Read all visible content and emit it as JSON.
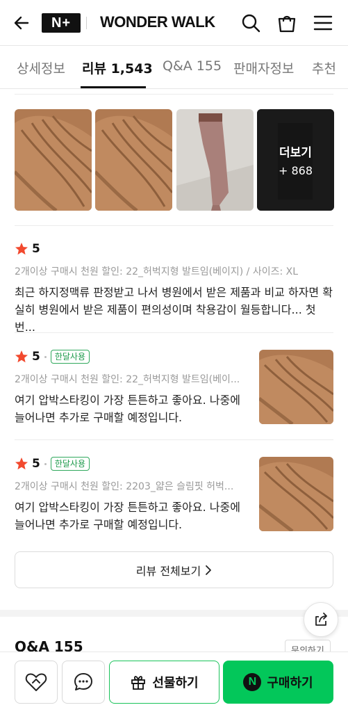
{
  "header": {
    "logo_text": "N+",
    "brand": "WONDER WALK"
  },
  "tabs": [
    {
      "label": "상세정보"
    },
    {
      "label": "리뷰 1,543"
    },
    {
      "label": "Q&A 155"
    },
    {
      "label": "판매자정보"
    },
    {
      "label": "추천"
    }
  ],
  "photos": {
    "more_label": "더보기",
    "more_count": "+ 868"
  },
  "reviews": [
    {
      "rating": "5",
      "badge": "",
      "option": "2개이상 구매시 천원 할인: 22_허벅지형 발트임(베이지) / 사이즈: XL",
      "text": "최근 하지정맥류 판정받고 나서 병원에서 받은 제품과 비교 하자면 확실히 병원에서 받은 제품이 편의성이며 착용감이 월등합니다... 첫번..."
    },
    {
      "rating": "5",
      "badge": "한달사용",
      "option": "2개이상 구매시 천원 할인: 22_허벅지형 발트임(베이...",
      "text": "여기 압박스타킹이 가장 튼튼하고 좋아요. 나중에 늘어나면 추가로 구매할 예정입니다."
    },
    {
      "rating": "5",
      "badge": "한달사용",
      "option": "2개이상 구매시 천원 할인: 2203_얇은 슬림핏 허벅...",
      "text": "여기 압박스타킹이 가장 튼튼하고 좋아요. 나중에 늘어나면 추가로 구매할 예정입니다."
    }
  ],
  "all_reviews_button": "리뷰 전체보기",
  "qa": {
    "title": "Q&A 155",
    "inquiry_button": "문의하기"
  },
  "bottom": {
    "gift_label": "선물하기",
    "buy_label": "구매하기",
    "buy_logo": "N"
  },
  "colors": {
    "accent_green": "#03c75a",
    "star_red": "#f2492e",
    "badge_green": "#1c9a4a"
  },
  "icons": [
    "back-arrow-icon",
    "search-icon",
    "cart-icon",
    "menu-icon",
    "star-icon",
    "chevron-right-icon",
    "share-icon",
    "heart-icon",
    "chat-icon",
    "gift-icon"
  ]
}
